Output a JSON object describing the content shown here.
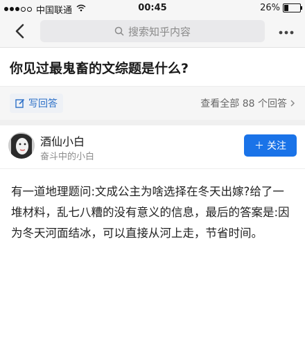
{
  "status_bar": {
    "carrier": "中国联通",
    "time": "00:45",
    "battery": "26%",
    "battery_level": 0.26
  },
  "nav": {
    "back_icon": "chevron-left-icon",
    "search_placeholder": "搜索知乎内容",
    "more_icon": "more-dots-icon"
  },
  "question": {
    "title": "你见过最鬼畜的文综题是什么?"
  },
  "actions": {
    "write_label": "写回答",
    "view_all_label": "查看全部 88 个回答"
  },
  "answer": {
    "author_name": "酒仙小白",
    "author_bio": "奋斗中的小白",
    "follow_label": "关注",
    "content": "有一道地理题问:文成公主为啥选择在冬天出嫁?给了一堆材料，乱七八糟的没有意义的信息，最后的答案是:因为冬天河面结冰，可以直接从河上走，节省时间。"
  },
  "colors": {
    "accent": "#1a73e8",
    "link": "#2b6fc7",
    "bg_bar": "#f6f6f6"
  }
}
